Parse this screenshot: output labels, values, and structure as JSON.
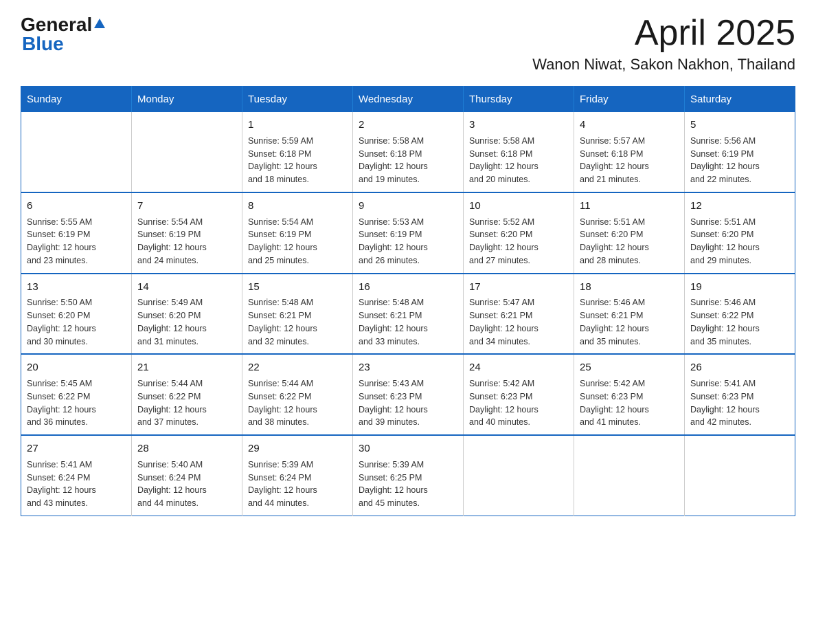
{
  "logo": {
    "general": "General",
    "arrow": "▲",
    "blue": "Blue"
  },
  "title": "April 2025",
  "subtitle": "Wanon Niwat, Sakon Nakhon, Thailand",
  "days_of_week": [
    "Sunday",
    "Monday",
    "Tuesday",
    "Wednesday",
    "Thursday",
    "Friday",
    "Saturday"
  ],
  "weeks": [
    [
      {
        "day": "",
        "info": ""
      },
      {
        "day": "",
        "info": ""
      },
      {
        "day": "1",
        "info": "Sunrise: 5:59 AM\nSunset: 6:18 PM\nDaylight: 12 hours\nand 18 minutes."
      },
      {
        "day": "2",
        "info": "Sunrise: 5:58 AM\nSunset: 6:18 PM\nDaylight: 12 hours\nand 19 minutes."
      },
      {
        "day": "3",
        "info": "Sunrise: 5:58 AM\nSunset: 6:18 PM\nDaylight: 12 hours\nand 20 minutes."
      },
      {
        "day": "4",
        "info": "Sunrise: 5:57 AM\nSunset: 6:18 PM\nDaylight: 12 hours\nand 21 minutes."
      },
      {
        "day": "5",
        "info": "Sunrise: 5:56 AM\nSunset: 6:19 PM\nDaylight: 12 hours\nand 22 minutes."
      }
    ],
    [
      {
        "day": "6",
        "info": "Sunrise: 5:55 AM\nSunset: 6:19 PM\nDaylight: 12 hours\nand 23 minutes."
      },
      {
        "day": "7",
        "info": "Sunrise: 5:54 AM\nSunset: 6:19 PM\nDaylight: 12 hours\nand 24 minutes."
      },
      {
        "day": "8",
        "info": "Sunrise: 5:54 AM\nSunset: 6:19 PM\nDaylight: 12 hours\nand 25 minutes."
      },
      {
        "day": "9",
        "info": "Sunrise: 5:53 AM\nSunset: 6:19 PM\nDaylight: 12 hours\nand 26 minutes."
      },
      {
        "day": "10",
        "info": "Sunrise: 5:52 AM\nSunset: 6:20 PM\nDaylight: 12 hours\nand 27 minutes."
      },
      {
        "day": "11",
        "info": "Sunrise: 5:51 AM\nSunset: 6:20 PM\nDaylight: 12 hours\nand 28 minutes."
      },
      {
        "day": "12",
        "info": "Sunrise: 5:51 AM\nSunset: 6:20 PM\nDaylight: 12 hours\nand 29 minutes."
      }
    ],
    [
      {
        "day": "13",
        "info": "Sunrise: 5:50 AM\nSunset: 6:20 PM\nDaylight: 12 hours\nand 30 minutes."
      },
      {
        "day": "14",
        "info": "Sunrise: 5:49 AM\nSunset: 6:20 PM\nDaylight: 12 hours\nand 31 minutes."
      },
      {
        "day": "15",
        "info": "Sunrise: 5:48 AM\nSunset: 6:21 PM\nDaylight: 12 hours\nand 32 minutes."
      },
      {
        "day": "16",
        "info": "Sunrise: 5:48 AM\nSunset: 6:21 PM\nDaylight: 12 hours\nand 33 minutes."
      },
      {
        "day": "17",
        "info": "Sunrise: 5:47 AM\nSunset: 6:21 PM\nDaylight: 12 hours\nand 34 minutes."
      },
      {
        "day": "18",
        "info": "Sunrise: 5:46 AM\nSunset: 6:21 PM\nDaylight: 12 hours\nand 35 minutes."
      },
      {
        "day": "19",
        "info": "Sunrise: 5:46 AM\nSunset: 6:22 PM\nDaylight: 12 hours\nand 35 minutes."
      }
    ],
    [
      {
        "day": "20",
        "info": "Sunrise: 5:45 AM\nSunset: 6:22 PM\nDaylight: 12 hours\nand 36 minutes."
      },
      {
        "day": "21",
        "info": "Sunrise: 5:44 AM\nSunset: 6:22 PM\nDaylight: 12 hours\nand 37 minutes."
      },
      {
        "day": "22",
        "info": "Sunrise: 5:44 AM\nSunset: 6:22 PM\nDaylight: 12 hours\nand 38 minutes."
      },
      {
        "day": "23",
        "info": "Sunrise: 5:43 AM\nSunset: 6:23 PM\nDaylight: 12 hours\nand 39 minutes."
      },
      {
        "day": "24",
        "info": "Sunrise: 5:42 AM\nSunset: 6:23 PM\nDaylight: 12 hours\nand 40 minutes."
      },
      {
        "day": "25",
        "info": "Sunrise: 5:42 AM\nSunset: 6:23 PM\nDaylight: 12 hours\nand 41 minutes."
      },
      {
        "day": "26",
        "info": "Sunrise: 5:41 AM\nSunset: 6:23 PM\nDaylight: 12 hours\nand 42 minutes."
      }
    ],
    [
      {
        "day": "27",
        "info": "Sunrise: 5:41 AM\nSunset: 6:24 PM\nDaylight: 12 hours\nand 43 minutes."
      },
      {
        "day": "28",
        "info": "Sunrise: 5:40 AM\nSunset: 6:24 PM\nDaylight: 12 hours\nand 44 minutes."
      },
      {
        "day": "29",
        "info": "Sunrise: 5:39 AM\nSunset: 6:24 PM\nDaylight: 12 hours\nand 44 minutes."
      },
      {
        "day": "30",
        "info": "Sunrise: 5:39 AM\nSunset: 6:25 PM\nDaylight: 12 hours\nand 45 minutes."
      },
      {
        "day": "",
        "info": ""
      },
      {
        "day": "",
        "info": ""
      },
      {
        "day": "",
        "info": ""
      }
    ]
  ]
}
